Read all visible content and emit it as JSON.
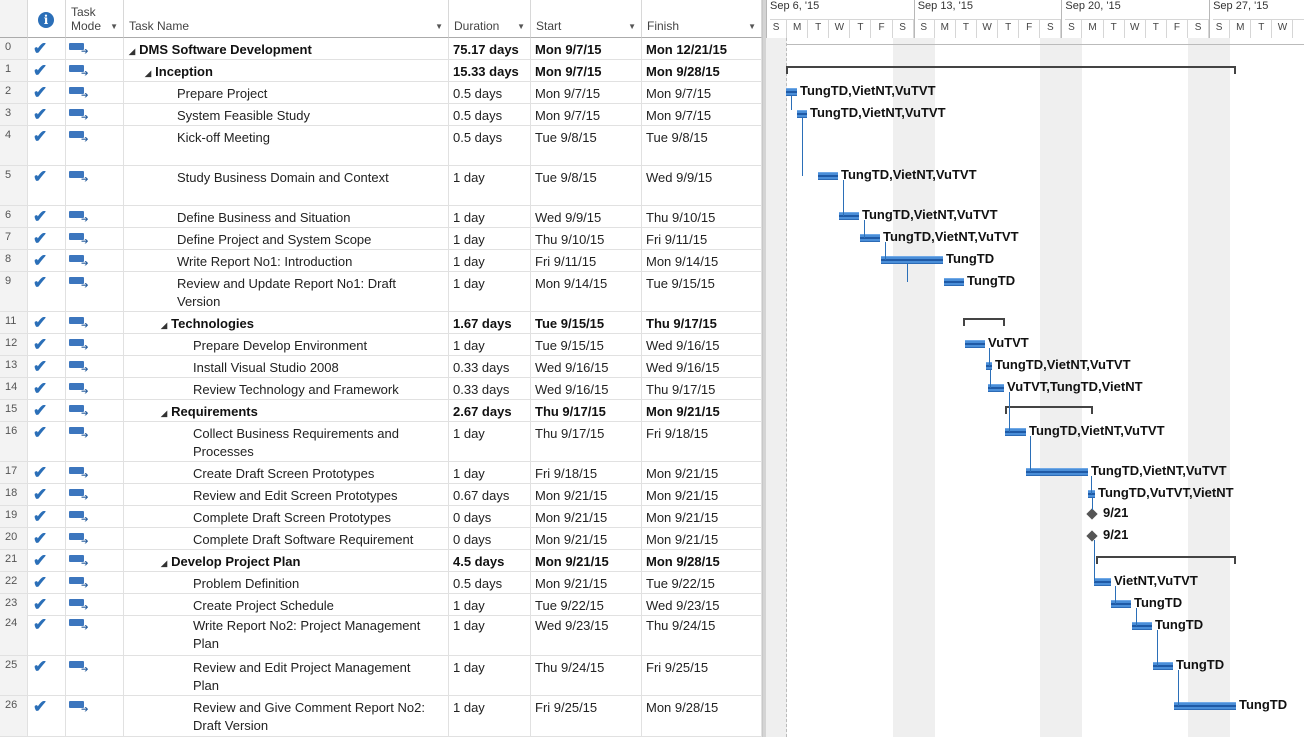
{
  "columns": {
    "task_mode": "Task\nMode",
    "task_name": "Task Name",
    "duration": "Duration",
    "start": "Start",
    "finish": "Finish"
  },
  "timescale": {
    "weeks": [
      "Sep 6, '15",
      "Sep 13, '15",
      "Sep 20, '15",
      "Sep 27, '15"
    ],
    "days": [
      "S",
      "M",
      "T",
      "W",
      "T",
      "F",
      "S",
      "S",
      "M",
      "T",
      "W",
      "T",
      "F",
      "S",
      "S",
      "M",
      "T",
      "W",
      "T",
      "F",
      "S",
      "S",
      "M",
      "T",
      "W"
    ]
  },
  "tasks": [
    {
      "id": "0",
      "name": "DMS Software Development",
      "duration": "75.17 days",
      "start": "Mon 9/7/15",
      "finish": "Mon 12/21/15",
      "level": 0,
      "summary": true
    },
    {
      "id": "1",
      "name": "Inception",
      "duration": "15.33 days",
      "start": "Mon 9/7/15",
      "finish": "Mon 9/28/15",
      "level": 1,
      "summary": true
    },
    {
      "id": "2",
      "name": "Prepare Project",
      "duration": "0.5 days",
      "start": "Mon 9/7/15",
      "finish": "Mon 9/7/15",
      "level": 2,
      "summary": false
    },
    {
      "id": "3",
      "name": "System Feasible Study",
      "duration": "0.5 days",
      "start": "Mon 9/7/15",
      "finish": "Mon 9/7/15",
      "level": 2,
      "summary": false
    },
    {
      "id": "4",
      "name": "Kick-off Meeting",
      "duration": "0.5 days",
      "start": "Tue 9/8/15",
      "finish": "Tue 9/8/15",
      "level": 2,
      "summary": false
    },
    {
      "id": "5",
      "name": "Study Business Domain and Context",
      "duration": "1 day",
      "start": "Tue 9/8/15",
      "finish": "Wed 9/9/15",
      "level": 2,
      "summary": false
    },
    {
      "id": "6",
      "name": "Define Business and Situation",
      "duration": "1 day",
      "start": "Wed 9/9/15",
      "finish": "Thu 9/10/15",
      "level": 2,
      "summary": false
    },
    {
      "id": "7",
      "name": "Define Project and System Scope",
      "duration": "1 day",
      "start": "Thu 9/10/15",
      "finish": "Fri 9/11/15",
      "level": 2,
      "summary": false
    },
    {
      "id": "8",
      "name": "Write Report No1: Introduction",
      "duration": "1 day",
      "start": "Fri 9/11/15",
      "finish": "Mon 9/14/15",
      "level": 2,
      "summary": false
    },
    {
      "id": "9",
      "name": "Review and Update Report No1: Draft\nVersion",
      "duration": "1 day",
      "start": "Mon 9/14/15",
      "finish": "Tue 9/15/15",
      "level": 2,
      "summary": false
    },
    {
      "id": "11",
      "name": "Technologies",
      "duration": "1.67 days",
      "start": "Tue 9/15/15",
      "finish": "Thu 9/17/15",
      "level": 2,
      "summary": true
    },
    {
      "id": "12",
      "name": "Prepare Develop Environment",
      "duration": "1 day",
      "start": "Tue 9/15/15",
      "finish": "Wed 9/16/15",
      "level": 3,
      "summary": false
    },
    {
      "id": "13",
      "name": "Install Visual Studio 2008",
      "duration": "0.33 days",
      "start": "Wed 9/16/15",
      "finish": "Wed 9/16/15",
      "level": 3,
      "summary": false
    },
    {
      "id": "14",
      "name": "Review Technology and Framework",
      "duration": "0.33 days",
      "start": "Wed 9/16/15",
      "finish": "Thu 9/17/15",
      "level": 3,
      "summary": false
    },
    {
      "id": "15",
      "name": "Requirements",
      "duration": "2.67 days",
      "start": "Thu 9/17/15",
      "finish": "Mon 9/21/15",
      "level": 2,
      "summary": true
    },
    {
      "id": "16",
      "name": "Collect Business Requirements and\nProcesses",
      "duration": "1 day",
      "start": "Thu 9/17/15",
      "finish": "Fri 9/18/15",
      "level": 3,
      "summary": false
    },
    {
      "id": "17",
      "name": "Create Draft Screen Prototypes",
      "duration": "1 day",
      "start": "Fri 9/18/15",
      "finish": "Mon 9/21/15",
      "level": 3,
      "summary": false
    },
    {
      "id": "18",
      "name": "Review and Edit Screen Prototypes",
      "duration": "0.67 days",
      "start": "Mon 9/21/15",
      "finish": "Mon 9/21/15",
      "level": 3,
      "summary": false
    },
    {
      "id": "19",
      "name": "Complete Draft Screen Prototypes",
      "duration": "0 days",
      "start": "Mon 9/21/15",
      "finish": "Mon 9/21/15",
      "level": 3,
      "summary": false
    },
    {
      "id": "20",
      "name": "Complete Draft Software Requirement",
      "duration": "0 days",
      "start": "Mon 9/21/15",
      "finish": "Mon 9/21/15",
      "level": 3,
      "summary": false
    },
    {
      "id": "21",
      "name": "Develop Project Plan",
      "duration": "4.5 days",
      "start": "Mon 9/21/15",
      "finish": "Mon 9/28/15",
      "level": 2,
      "summary": true
    },
    {
      "id": "22",
      "name": "Problem Definition",
      "duration": "0.5 days",
      "start": "Mon 9/21/15",
      "finish": "Tue 9/22/15",
      "level": 3,
      "summary": false
    },
    {
      "id": "23",
      "name": "Create Project Schedule",
      "duration": "1 day",
      "start": "Tue 9/22/15",
      "finish": "Wed 9/23/15",
      "level": 3,
      "summary": false
    },
    {
      "id": "24",
      "name": "Write Report No2: Project Management\nPlan",
      "duration": "1 day",
      "start": "Wed 9/23/15",
      "finish": "Thu 9/24/15",
      "level": 3,
      "summary": false
    },
    {
      "id": "25",
      "name": "Review and Edit Project Management\nPlan",
      "duration": "1 day",
      "start": "Thu 9/24/15",
      "finish": "Fri 9/25/15",
      "level": 3,
      "summary": false
    },
    {
      "id": "26",
      "name": "Review and Give Comment Report No2:\nDraft Version",
      "duration": "1 day",
      "start": "Fri 9/25/15",
      "finish": "Mon 9/28/15",
      "level": 3,
      "summary": false
    }
  ],
  "gantt_labels": [
    {
      "task": "2",
      "text": "TungTD,VietNT,VuTVT"
    },
    {
      "task": "3",
      "text": "TungTD,VietNT,VuTVT"
    },
    {
      "task": "5",
      "text": "TungTD,VietNT,VuTVT"
    },
    {
      "task": "6",
      "text": "TungTD,VietNT,VuTVT"
    },
    {
      "task": "7",
      "text": "TungTD,VietNT,VuTVT"
    },
    {
      "task": "8",
      "text": "TungTD"
    },
    {
      "task": "9",
      "text": "TungTD"
    },
    {
      "task": "12",
      "text": "VuTVT"
    },
    {
      "task": "13",
      "text": "TungTD,VietNT,VuTVT"
    },
    {
      "task": "14",
      "text": "VuTVT,TungTD,VietNT"
    },
    {
      "task": "16",
      "text": "TungTD,VietNT,VuTVT"
    },
    {
      "task": "17",
      "text": "TungTD,VietNT,VuTVT"
    },
    {
      "task": "18",
      "text": "TungTD,VuTVT,VietNT"
    },
    {
      "task": "19",
      "text": "9/21"
    },
    {
      "task": "20",
      "text": "9/21"
    },
    {
      "task": "22",
      "text": "VietNT,VuTVT"
    },
    {
      "task": "23",
      "text": "TungTD"
    },
    {
      "task": "24",
      "text": "TungTD"
    },
    {
      "task": "25",
      "text": "TungTD"
    },
    {
      "task": "26",
      "text": "TungTD"
    }
  ]
}
